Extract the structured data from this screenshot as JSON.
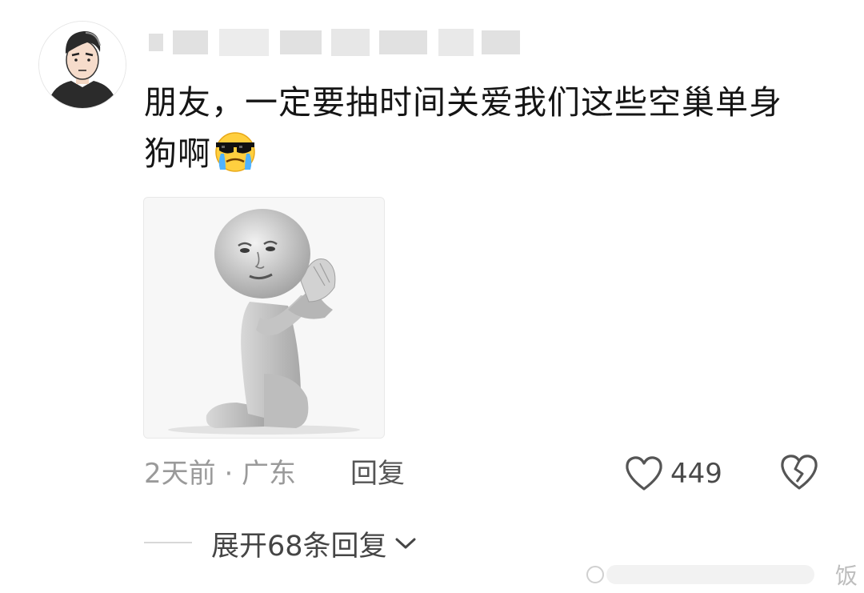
{
  "comment": {
    "username": "",
    "text": "朋友，一定要抽时间关爱我们这些空巢单身狗啊",
    "emoji": "crying-cool-emoji",
    "time_location": "2天前 · 广东",
    "reply_label": "回复",
    "like_count": "449",
    "expand_label": "展开68条回复"
  },
  "icons": {
    "like": "heart-outline-icon",
    "dislike": "broken-heart-icon",
    "expand": "chevron-down-icon"
  },
  "watermark": {
    "text": "饭"
  },
  "colors": {
    "text_primary": "#151515",
    "text_meta": "#9a9a9a",
    "text_secondary": "#555555",
    "background": "#ffffff"
  }
}
